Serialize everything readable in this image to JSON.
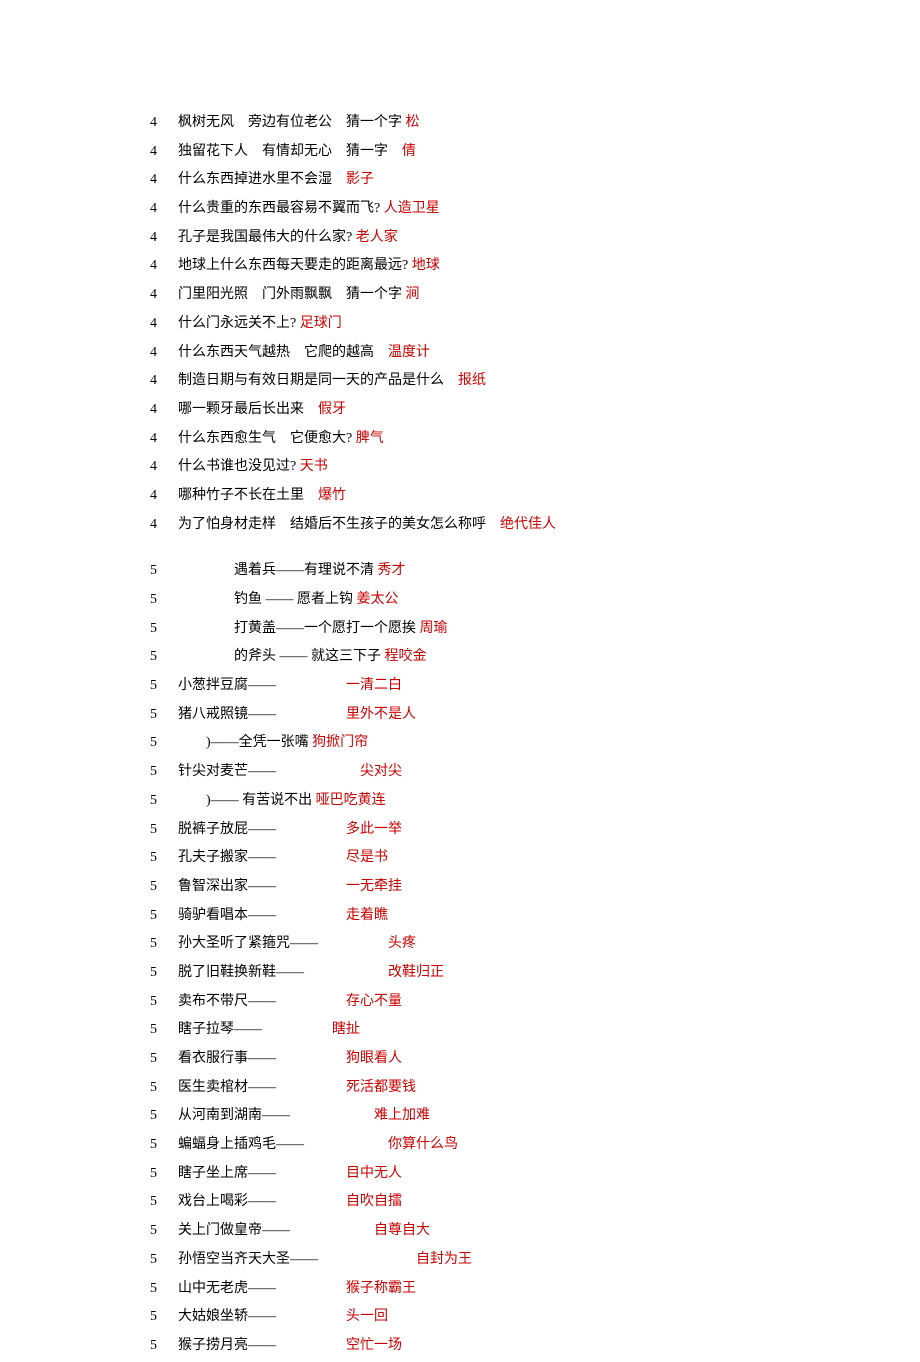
{
  "lines": [
    {
      "n": "4",
      "parts": [
        {
          "t": "枫树无风　旁边有位老公　猜一个字 ",
          "c": "q"
        },
        {
          "t": "松",
          "c": "a"
        }
      ]
    },
    {
      "n": "4",
      "parts": [
        {
          "t": "独留花下人　有情却无心　猜一字　",
          "c": "q"
        },
        {
          "t": "倩",
          "c": "a"
        }
      ]
    },
    {
      "n": "4",
      "parts": [
        {
          "t": "什么东西掉进水里不会湿　",
          "c": "q"
        },
        {
          "t": "影子",
          "c": "a"
        }
      ]
    },
    {
      "n": "4",
      "parts": [
        {
          "t": "什么贵重的东西最容易不翼而飞? ",
          "c": "q"
        },
        {
          "t": "人造卫星",
          "c": "a"
        }
      ]
    },
    {
      "n": "4",
      "parts": [
        {
          "t": "孔子是我国最伟大的什么家? ",
          "c": "q"
        },
        {
          "t": "老人家",
          "c": "a"
        }
      ]
    },
    {
      "n": "4",
      "parts": [
        {
          "t": "地球上什么东西每天要走的距离最远? ",
          "c": "q"
        },
        {
          "t": "地球",
          "c": "a"
        }
      ]
    },
    {
      "n": "4",
      "parts": [
        {
          "t": "门里阳光照　门外雨飘飘　猜一个字 ",
          "c": "q"
        },
        {
          "t": "涧",
          "c": "a"
        }
      ]
    },
    {
      "n": "4",
      "parts": [
        {
          "t": "什么门永远关不上? ",
          "c": "q"
        },
        {
          "t": "足球门",
          "c": "a"
        }
      ]
    },
    {
      "n": "4",
      "parts": [
        {
          "t": "什么东西天气越热　它爬的越高　",
          "c": "q"
        },
        {
          "t": "温度计",
          "c": "a"
        }
      ]
    },
    {
      "n": "4",
      "parts": [
        {
          "t": "制造日期与有效日期是同一天的产品是什么　",
          "c": "q"
        },
        {
          "t": "报纸",
          "c": "a"
        }
      ]
    },
    {
      "n": "4",
      "parts": [
        {
          "t": "哪一颗牙最后长出来　",
          "c": "q"
        },
        {
          "t": "假牙",
          "c": "a"
        }
      ]
    },
    {
      "n": "4",
      "parts": [
        {
          "t": "什么东西愈生气　它便愈大? ",
          "c": "q"
        },
        {
          "t": "脾气",
          "c": "a"
        }
      ]
    },
    {
      "n": "4",
      "parts": [
        {
          "t": "什么书谁也没见过? ",
          "c": "q"
        },
        {
          "t": "天书",
          "c": "a"
        }
      ]
    },
    {
      "n": "4",
      "parts": [
        {
          "t": "哪种竹子不长在土里　",
          "c": "q"
        },
        {
          "t": "爆竹",
          "c": "a"
        }
      ]
    },
    {
      "n": "4",
      "parts": [
        {
          "t": "为了怕身材走样　结婚后不生孩子的美女怎么称呼　",
          "c": "q"
        },
        {
          "t": "绝代佳人",
          "c": "a"
        }
      ]
    },
    {
      "spacer": true
    },
    {
      "n": "5",
      "parts": [
        {
          "t": "　　　　遇着兵——有理说不清 ",
          "c": "q"
        },
        {
          "t": "秀才",
          "c": "a"
        }
      ]
    },
    {
      "n": "5",
      "parts": [
        {
          "t": "　　　　钓鱼 —— 愿者上钩 ",
          "c": "q"
        },
        {
          "t": "姜太公",
          "c": "a"
        }
      ]
    },
    {
      "n": "5",
      "parts": [
        {
          "t": "　　　　打黄盖——一个愿打一个愿挨 ",
          "c": "q"
        },
        {
          "t": "周瑜",
          "c": "a"
        }
      ]
    },
    {
      "n": "5",
      "parts": [
        {
          "t": "　　　　的斧头 —— 就这三下子 ",
          "c": "q"
        },
        {
          "t": "程咬金",
          "c": "a"
        }
      ]
    },
    {
      "n": "5",
      "parts": [
        {
          "t": "小葱拌豆腐——　　　　　",
          "c": "q"
        },
        {
          "t": "一清二白",
          "c": "a"
        }
      ]
    },
    {
      "n": "5",
      "parts": [
        {
          "t": "猪八戒照镜——　　　　　",
          "c": "q"
        },
        {
          "t": "里外不是人",
          "c": "a"
        }
      ]
    },
    {
      "n": "5",
      "parts": [
        {
          "t": "　　)——全凭一张嘴 ",
          "c": "q"
        },
        {
          "t": "狗掀门帘",
          "c": "a"
        }
      ]
    },
    {
      "n": "5",
      "parts": [
        {
          "t": "针尖对麦芒——　　　　　　",
          "c": "q"
        },
        {
          "t": "尖对尖",
          "c": "a"
        }
      ]
    },
    {
      "n": "5",
      "parts": [
        {
          "t": "　　)—— 有苦说不出 ",
          "c": "q"
        },
        {
          "t": "哑巴吃黄连",
          "c": "a"
        }
      ]
    },
    {
      "n": "5",
      "parts": [
        {
          "t": "脱裤子放屁——　　　　　",
          "c": "q"
        },
        {
          "t": "多此一举",
          "c": "a"
        }
      ]
    },
    {
      "n": "5",
      "parts": [
        {
          "t": "孔夫子搬家——　　　　　",
          "c": "q"
        },
        {
          "t": "尽是书",
          "c": "a"
        }
      ]
    },
    {
      "n": "5",
      "parts": [
        {
          "t": "鲁智深出家——　　　　　",
          "c": "q"
        },
        {
          "t": "一无牵挂",
          "c": "a"
        }
      ]
    },
    {
      "n": "5",
      "parts": [
        {
          "t": "骑驴看唱本——　　　　　",
          "c": "q"
        },
        {
          "t": "走着瞧",
          "c": "a"
        }
      ]
    },
    {
      "n": "5",
      "parts": [
        {
          "t": "孙大圣听了紧箍咒——　　　　　",
          "c": "q"
        },
        {
          "t": "头疼",
          "c": "a"
        }
      ]
    },
    {
      "n": "5",
      "parts": [
        {
          "t": "脱了旧鞋换新鞋——　　　　　　",
          "c": "q"
        },
        {
          "t": "改鞋归正",
          "c": "a"
        }
      ]
    },
    {
      "n": "5",
      "parts": [
        {
          "t": "卖布不带尺——　　　　　",
          "c": "q"
        },
        {
          "t": "存心不量",
          "c": "a"
        }
      ]
    },
    {
      "n": "5",
      "parts": [
        {
          "t": "瞎子拉琴——　　　　　",
          "c": "q"
        },
        {
          "t": "瞎扯",
          "c": "a"
        }
      ]
    },
    {
      "n": "5",
      "parts": [
        {
          "t": "看衣服行事——　　　　　",
          "c": "q"
        },
        {
          "t": "狗眼看人",
          "c": "a"
        }
      ]
    },
    {
      "n": "5",
      "parts": [
        {
          "t": "医生卖棺材——　　　　　",
          "c": "q"
        },
        {
          "t": "死活都要钱",
          "c": "a"
        }
      ]
    },
    {
      "n": "5",
      "parts": [
        {
          "t": "从河南到湖南——　　　　　　",
          "c": "q"
        },
        {
          "t": "难上加难",
          "c": "a"
        }
      ]
    },
    {
      "n": "5",
      "parts": [
        {
          "t": "蝙蝠身上插鸡毛——　　　　　　",
          "c": "q"
        },
        {
          "t": "你算什么鸟",
          "c": "a"
        }
      ]
    },
    {
      "n": "5",
      "parts": [
        {
          "t": "瞎子坐上席——　　　　　",
          "c": "q"
        },
        {
          "t": "目中无人",
          "c": "a"
        }
      ]
    },
    {
      "n": "5",
      "parts": [
        {
          "t": "戏台上喝彩——　　　　　",
          "c": "q"
        },
        {
          "t": "自吹自擂",
          "c": "a"
        }
      ]
    },
    {
      "n": "5",
      "parts": [
        {
          "t": "关上门做皇帝——　　　　　　",
          "c": "q"
        },
        {
          "t": "自尊自大",
          "c": "a"
        }
      ]
    },
    {
      "n": "5",
      "parts": [
        {
          "t": "孙悟空当齐天大圣——　　　　　　　",
          "c": "q"
        },
        {
          "t": "自封为王",
          "c": "a"
        }
      ]
    },
    {
      "n": "5",
      "parts": [
        {
          "t": "山中无老虎——　　　　　",
          "c": "q"
        },
        {
          "t": "猴子称霸王",
          "c": "a"
        }
      ]
    },
    {
      "n": "5",
      "parts": [
        {
          "t": "大姑娘坐轿——　　　　　",
          "c": "q"
        },
        {
          "t": "头一回",
          "c": "a"
        }
      ]
    },
    {
      "n": "5",
      "parts": [
        {
          "t": "猴子捞月亮——　　　　　",
          "c": "q"
        },
        {
          "t": "空忙一场",
          "c": "a"
        }
      ]
    }
  ]
}
